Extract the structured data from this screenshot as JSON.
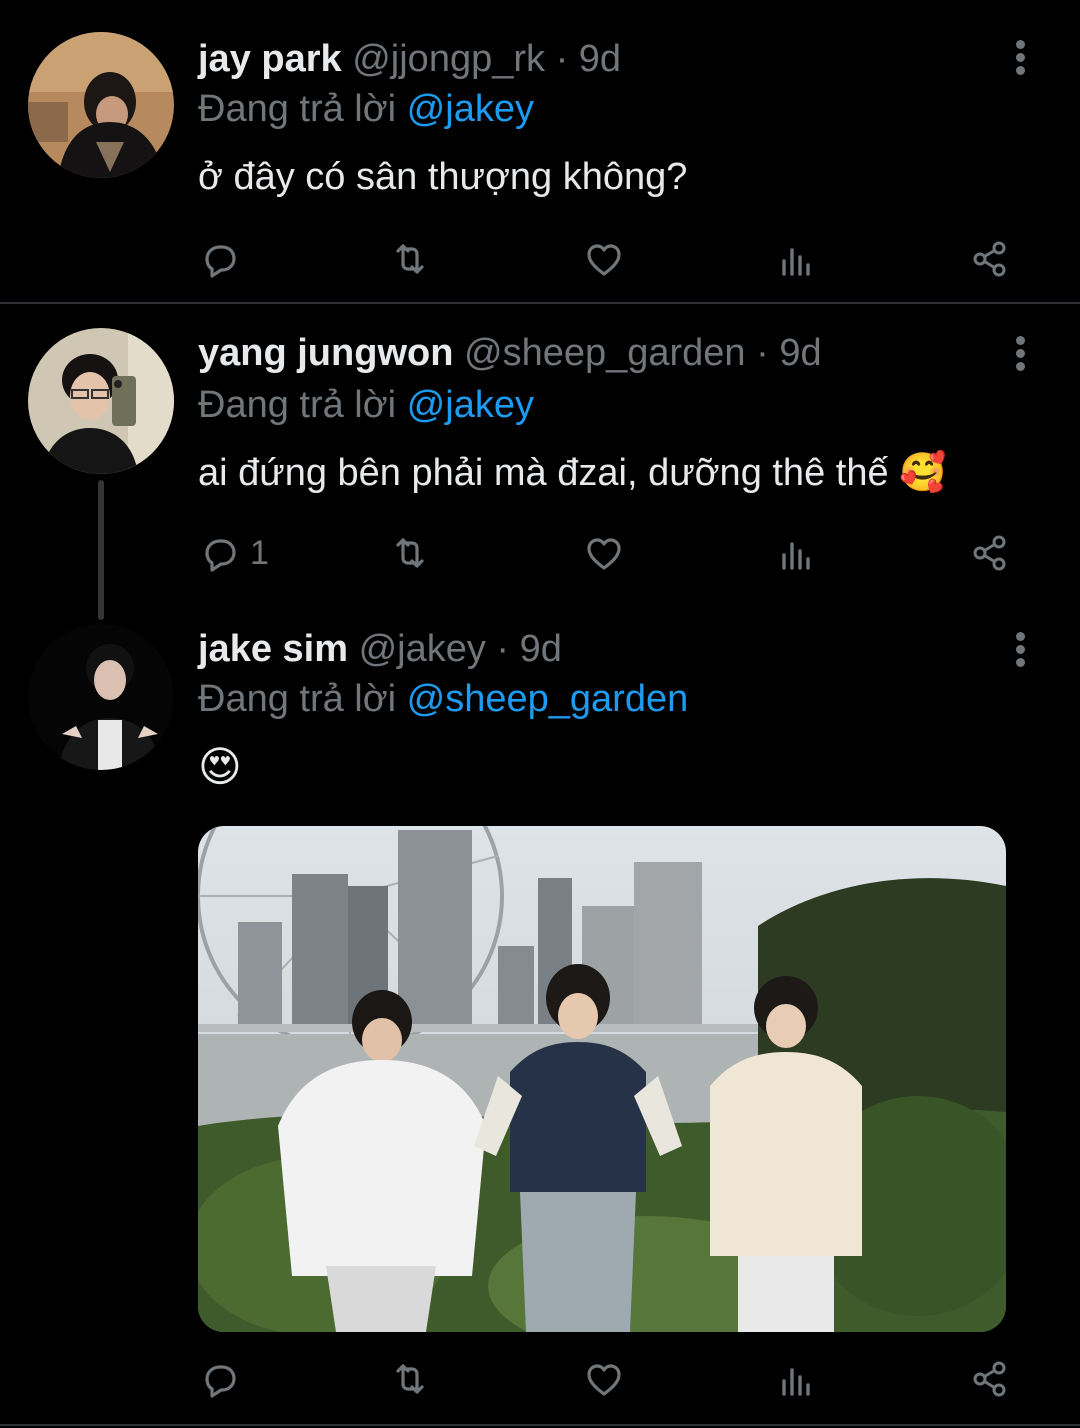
{
  "tweets": [
    {
      "name": "jay park",
      "handle": "@jjongp_rk",
      "time": "9d",
      "replying_prefix": "Đang trả lời",
      "replying_to": "@jakey",
      "text": "ở đây có sân thượng không?",
      "reply_count": ""
    },
    {
      "name": "yang jungwon",
      "handle": "@sheep_garden",
      "time": "9d",
      "replying_prefix": "Đang trả lời",
      "replying_to": "@jakey",
      "text": "ai đứng bên phải mà đzai, dưỡng thê thế 🥰",
      "reply_count": "1"
    },
    {
      "name": "jake sim",
      "handle": "@jakey",
      "time": "9d",
      "replying_prefix": "Đang trả lời",
      "replying_to": "@sheep_garden",
      "text": "😍",
      "reply_count": ""
    }
  ],
  "separator": "·",
  "icons": [
    "reply-icon",
    "retweet-icon",
    "like-icon",
    "views-icon",
    "share-icon",
    "more-icon"
  ],
  "colors": {
    "background": "#000000",
    "primary_text": "#e7e9ea",
    "secondary_text": "#71767b",
    "link": "#1d9bf0",
    "divider": "#2f3336"
  }
}
